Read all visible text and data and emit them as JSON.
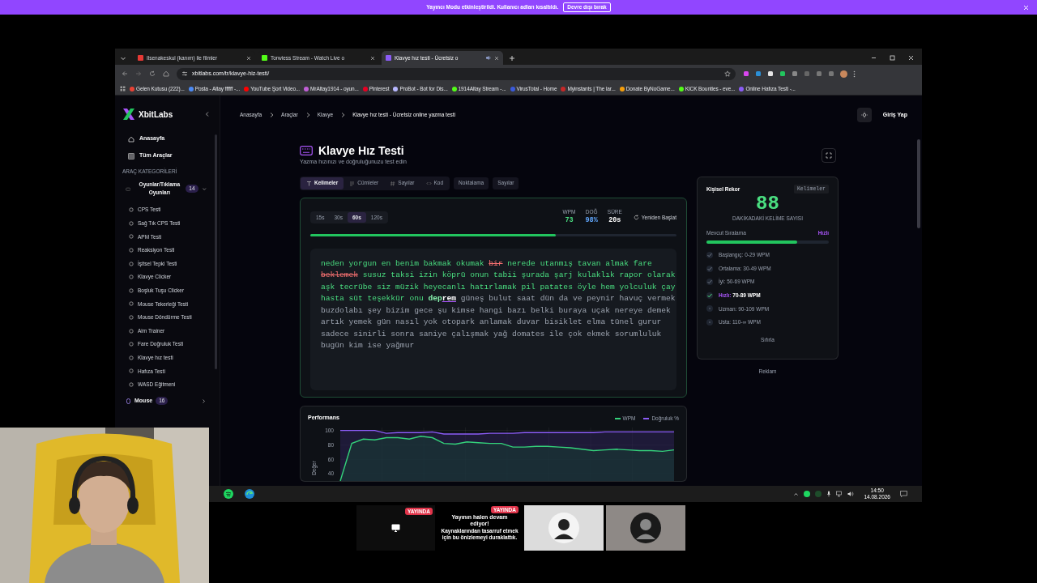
{
  "stream_banner": {
    "text": "Yayıncı Modu etkinleştirildi. Kullanıcı adları kısaltıldı.",
    "button": "Devre dışı bırak"
  },
  "browser": {
    "tabs": [
      {
        "title": "Ilsenakeskul (kanım) ile filmler",
        "selected": false,
        "audio": false,
        "color": "#e53935"
      },
      {
        "title": "Torwiess Stream - Watch Live o",
        "selected": false,
        "audio": false,
        "color": "#53fc18"
      },
      {
        "title": "Klavye hız testi - Ücretsiz o",
        "selected": true,
        "audio": true,
        "color": "#8b5cf6"
      }
    ],
    "url": "xbitlabs.com/tr/klavye-hiz-testi/",
    "bookmarks": [
      {
        "label": "Gelen Kutusu (222)...",
        "color": "#ea4335"
      },
      {
        "label": "Posta - Altay ffffff -...",
        "color": "#4c8bf5"
      },
      {
        "label": "YouTube Şort Video...",
        "color": "#ff0000"
      },
      {
        "label": "MrAltay1914 - oyun...",
        "color": "#c05fd6"
      },
      {
        "label": "Pinterest",
        "color": "#e60023"
      },
      {
        "label": "ProBot - Bot for Dis...",
        "color": "#b8b8ff"
      },
      {
        "label": "1914Altay Stream -...",
        "color": "#53fc18"
      },
      {
        "label": "VirusTotal - Home",
        "color": "#3b5bdb"
      },
      {
        "label": "Myinstants | The lar...",
        "color": "#c62828"
      },
      {
        "label": "Donate ByNoGame...",
        "color": "#f59e0b"
      },
      {
        "label": "KICK Bounties - eve...",
        "color": "#53fc18"
      },
      {
        "label": "Online Hafıza Testi -...",
        "color": "#8b5cf6"
      }
    ]
  },
  "sidebar": {
    "brand": "XbitLabs",
    "nav": [
      "Anasayfa",
      "Tüm Araçlar"
    ],
    "heading": "ARAÇ KATEGORİLERİ",
    "categories": [
      {
        "label": "Oyunlar/Tıklama Oyunları",
        "count": "14",
        "expanded": true,
        "children": [
          "CPS Testi",
          "Sağ Tık CPS Testi",
          "APM Testi",
          "Reaksiyon Testi",
          "İşitsel Tepki Testi",
          "Klavye Clicker",
          "Boşluk Tuşu Clicker",
          "Mouse Tekerleği Testi",
          "Mouse Döndürme Testi",
          "Aim Trainer",
          "Fare Doğruluk Testi",
          "Klavye hız testi",
          "Hafıza Testi",
          "WASD Eğitmeni"
        ]
      },
      {
        "label": "Mouse",
        "count": "16",
        "expanded": false
      }
    ]
  },
  "breadcrumbs": [
    "Anasayfa",
    "Araçlar",
    "Klavye",
    "Klavye hız testi - Ücretsiz online yazma testi"
  ],
  "login": "Giriş Yap",
  "title": "Klavye Hız Testi",
  "subtitle": "Yazma hızınızı ve doğruluğunuzu test edin",
  "modes": [
    {
      "label": "Kelimeler",
      "selected": true
    },
    {
      "label": "Cümleler",
      "selected": false
    },
    {
      "label": "Sayılar",
      "selected": false
    },
    {
      "label": "Kod",
      "selected": false
    }
  ],
  "options": [
    {
      "label": "Noktalama",
      "on": false
    },
    {
      "label": "Sayılar",
      "on": false
    }
  ],
  "durations": [
    {
      "label": "15s",
      "selected": false
    },
    {
      "label": "30s",
      "selected": false
    },
    {
      "label": "60s",
      "selected": true
    },
    {
      "label": "120s",
      "selected": false
    }
  ],
  "stats": [
    {
      "label": "WPM",
      "value": "73",
      "color": "#4ade80"
    },
    {
      "label": "DOĞ",
      "value": "98%",
      "color": "#60a5fa"
    },
    {
      "label": "SÜRE",
      "value": "20s",
      "color": "#ffffff"
    }
  ],
  "restart": "Yeniden Başlat",
  "progress": {
    "level": 0.67
  },
  "typing": [
    {
      "text": "neden yorgun en benim bakmak okumak",
      "kind": "correct"
    },
    {
      "text": "bir",
      "kind": "wrong"
    },
    {
      "text": "nerede utanmış tavan almak fare",
      "kind": "correct"
    },
    {
      "text": "beklemek",
      "kind": "wrong"
    },
    {
      "text": "susuz taksi izin köprü onun tabii şurada şarj kulaklık rapor olarak aşk tecrübe siz müzik heyecanlı hatırlamak pil patates öyle hem yolculuk çay hasta süt teşekkür onu",
      "kind": "correct"
    },
    {
      "text": "dep",
      "kind": "typed"
    },
    {
      "text": "rem",
      "kind": "current"
    },
    {
      "text": "güneş bulut saat dün da ve peynir havuç vermek buzdolabı şey bizim gece şu kimse hangi bazı belki buraya uçak nereye demek artık yemek gün nasıl yok otopark anlamak duvar bisiklet elma tünel gurur sadece sinirli sonra saniye çalışmak yağ domates ile çok ekmek sorumluluk bugün kim ise yağmur",
      "kind": "pending"
    }
  ],
  "performance": {
    "chart_data": {
      "type": "line",
      "title": "Performans",
      "ylabel": "Değer",
      "ylim": [
        30,
        104
      ],
      "yticks": [
        40,
        60,
        80,
        100
      ],
      "series": [
        {
          "name": "WPM",
          "color": "#34d27b",
          "values": [
            30,
            82,
            88,
            87,
            90,
            90,
            88,
            92,
            90,
            82,
            81,
            84,
            83,
            82,
            82,
            77,
            77,
            78,
            78,
            77,
            76,
            74,
            72,
            73,
            74,
            73,
            72,
            72,
            71,
            73
          ]
        },
        {
          "name": "Doğruluk %",
          "color": "#8b5cf6",
          "values": [
            100,
            100,
            100,
            100,
            96,
            97,
            97,
            97,
            98,
            95,
            95,
            95,
            95,
            96,
            96,
            96,
            97,
            97,
            97,
            97,
            97,
            97,
            97,
            98,
            98,
            98,
            98,
            98,
            98,
            98
          ]
        }
      ]
    }
  },
  "record": {
    "title": "Kişisel Rekor",
    "chip": "Kelimeler",
    "value": "88",
    "caption": "DAKİKADAKİ KELİME SAYISI",
    "rank_label": "Mevcut Sıralama",
    "rank": "Hızlı",
    "level": 0.74,
    "ranks": [
      {
        "name": "Başlangıç:",
        "range": "0-29 WPM",
        "achieved": true,
        "selected": false
      },
      {
        "name": "Ortalama:",
        "range": "30-49 WPM",
        "achieved": true,
        "selected": false
      },
      {
        "name": "İyi:",
        "range": "50-69 WPM",
        "achieved": true,
        "selected": false
      },
      {
        "name": "Hızlı:",
        "range": "70-89 WPM",
        "achieved": true,
        "selected": true
      },
      {
        "name": "Uzman:",
        "range": "90-109 WPM",
        "achieved": false,
        "selected": false
      },
      {
        "name": "Usta:",
        "range": "110-∞ WPM",
        "achieved": false,
        "selected": false
      }
    ],
    "reset": "Sıfırla"
  },
  "ad_label": "Reklam",
  "taskbar": {
    "time": "14:50",
    "date": "14.08.2026"
  },
  "previews": [
    {
      "kind": "screen",
      "badge": "YAYINDA",
      "color": "#0d0d0d"
    },
    {
      "kind": "paused",
      "badge": "YAYINDA",
      "title": "Yayının halen devam ediyor!",
      "message": "Kaynaklarından tasarruf etmek için bu önizlemeyi duraklattık."
    },
    {
      "kind": "avatar",
      "color": "#dcdcdc"
    },
    {
      "kind": "avatar",
      "color": "#8e8986"
    }
  ]
}
